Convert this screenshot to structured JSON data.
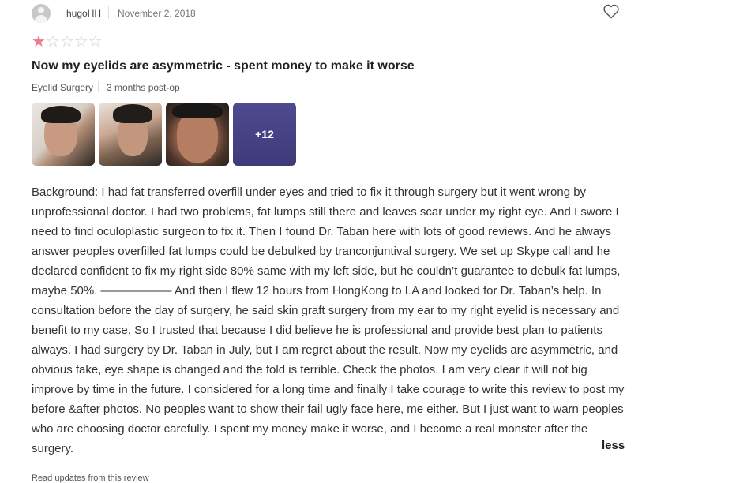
{
  "review_header": {
    "username": "hugoHH",
    "date": "November 2, 2018"
  },
  "rating": {
    "value": 1,
    "max": 5
  },
  "title": "Now my eyelids are asymmetric - spent money to make it worse",
  "meta": {
    "procedure": "Eyelid Surgery",
    "timing": "3 months post-op"
  },
  "photos": {
    "more_label": "+12"
  },
  "body_text": "Background: I had fat transferred overfill under eyes and tried to fix it through surgery but it went wrong by unprofessional doctor. I had two problems, fat lumps still there and leaves scar under my right eye. And I swore I need to find oculoplastic surgeon to fix it. Then I found Dr. Taban here with lots of good reviews. And he always answer peoples overfilled fat lumps could be debulked by tranconjuntival surgery. We set up Skype call and he declared confident to fix my right side 80% same with my left side, but he couldn’t guarantee to debulk fat lumps, maybe 50%. —————— And then I flew 12 hours from HongKong to LA and looked for Dr. Taban’s help. In consultation before the day of surgery, he said skin graft surgery from my ear to my right eyelid is necessary and benefit to my case. So I trusted that because I did believe he is professional and provide best plan to patients always. I had surgery by Dr. Taban in July, but I am regret about the result. Now my eyelids are asymmetric, and obvious fake, eye shape is changed and the fold is terrible. Check the photos. I am very clear it will not big improve by time in the future. I considered for a long time and finally I take courage to write this review to post my before &after photos. No peoples want to show their fail ugly face here, me either. But I just want to warn peoples who are choosing doctor carefully. I spent my money make it worse, and I become a real monster after the surgery.",
  "less_label": "less",
  "updates_link": "Read updates from this review",
  "colors": {
    "star_filled": "#f07a8a",
    "star_empty": "#cfcfcf"
  },
  "icons": {
    "favorite": "heart-icon",
    "avatar": "user-avatar-icon"
  }
}
